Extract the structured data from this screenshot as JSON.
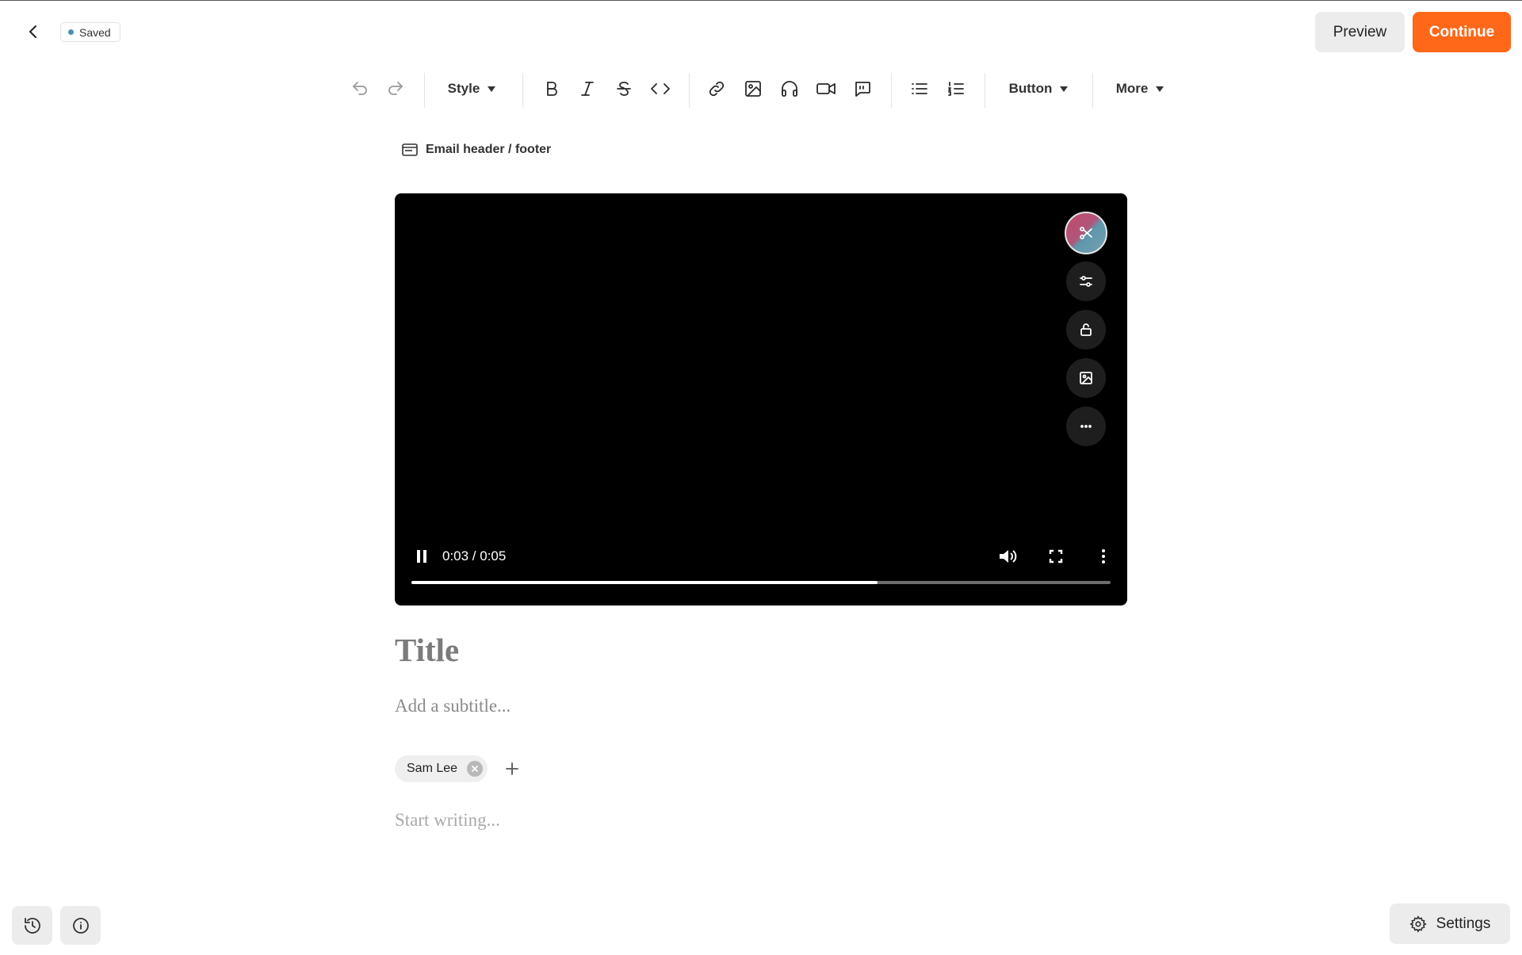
{
  "header": {
    "status": "Saved",
    "status_color": "#4a8fb0",
    "preview_label": "Preview",
    "continue_label": "Continue",
    "accent_color": "#ff6719"
  },
  "toolbar": {
    "style_label": "Style",
    "button_label": "Button",
    "more_label": "More",
    "icons": [
      "undo-icon",
      "redo-icon",
      "bold-icon",
      "italic-icon",
      "strikethrough-icon",
      "code-icon",
      "link-icon",
      "image-icon",
      "audio-icon",
      "video-icon",
      "quote-icon",
      "bullet-list-icon",
      "numbered-list-icon"
    ]
  },
  "editor": {
    "email_header_footer": "Email header / footer",
    "title_placeholder": "Title",
    "subtitle_placeholder": "Add a subtitle...",
    "author": "Sam Lee",
    "body_placeholder": "Start writing..."
  },
  "video": {
    "time_display": "0:03 / 0:05",
    "progress": 0.667,
    "side_controls": [
      "trim-icon",
      "sliders-icon",
      "unlock-icon",
      "image-icon",
      "more-horizontal-icon"
    ]
  },
  "footer": {
    "settings_label": "Settings"
  }
}
